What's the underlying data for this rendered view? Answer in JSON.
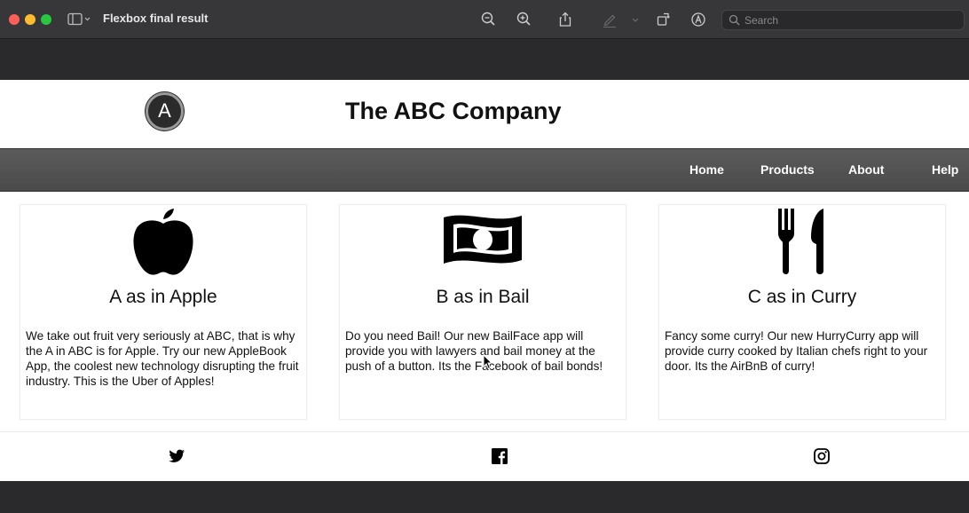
{
  "window": {
    "title": "Flexbox final result",
    "search_placeholder": "Search"
  },
  "toolbar": {
    "icons": [
      "sidebar-icon",
      "zoom-out-icon",
      "zoom-in-icon",
      "share-icon",
      "markup-pen-icon",
      "rotate-icon",
      "annotate-icon",
      "search-icon"
    ]
  },
  "site": {
    "logo_letter": "A",
    "title": "The ABC Company"
  },
  "nav": {
    "items": [
      {
        "label": "Home"
      },
      {
        "label": "Products"
      },
      {
        "label": "About"
      },
      {
        "label": "Help"
      }
    ]
  },
  "cards": [
    {
      "icon": "apple-icon",
      "title": "A as in Apple",
      "text": "We take out fruit very seriously at ABC, that is why the A in ABC is for Apple. Try our new AppleBook App, the coolest new technology disrupting the fruit industry. This is the Uber of Apples!"
    },
    {
      "icon": "money-bill-icon",
      "title": "B as in Bail",
      "text": "Do you need Bail! Our new BailFace app will provide you with lawyers and bail money at the push of a button. Its the Facebook of bail bonds!"
    },
    {
      "icon": "fork-knife-icon",
      "title": "C as in Curry",
      "text": "Fancy some curry! Our new HurryCurry app will provide curry cooked by Italian chefs right to your door. Its the AirBnB of curry!"
    }
  ],
  "footer": {
    "icons": [
      "twitter-icon",
      "facebook-icon",
      "instagram-icon"
    ]
  },
  "colors": {
    "nav_bg": "#4f4f4f",
    "chrome_bg": "#37373a",
    "page_bg": "#ffffff"
  }
}
